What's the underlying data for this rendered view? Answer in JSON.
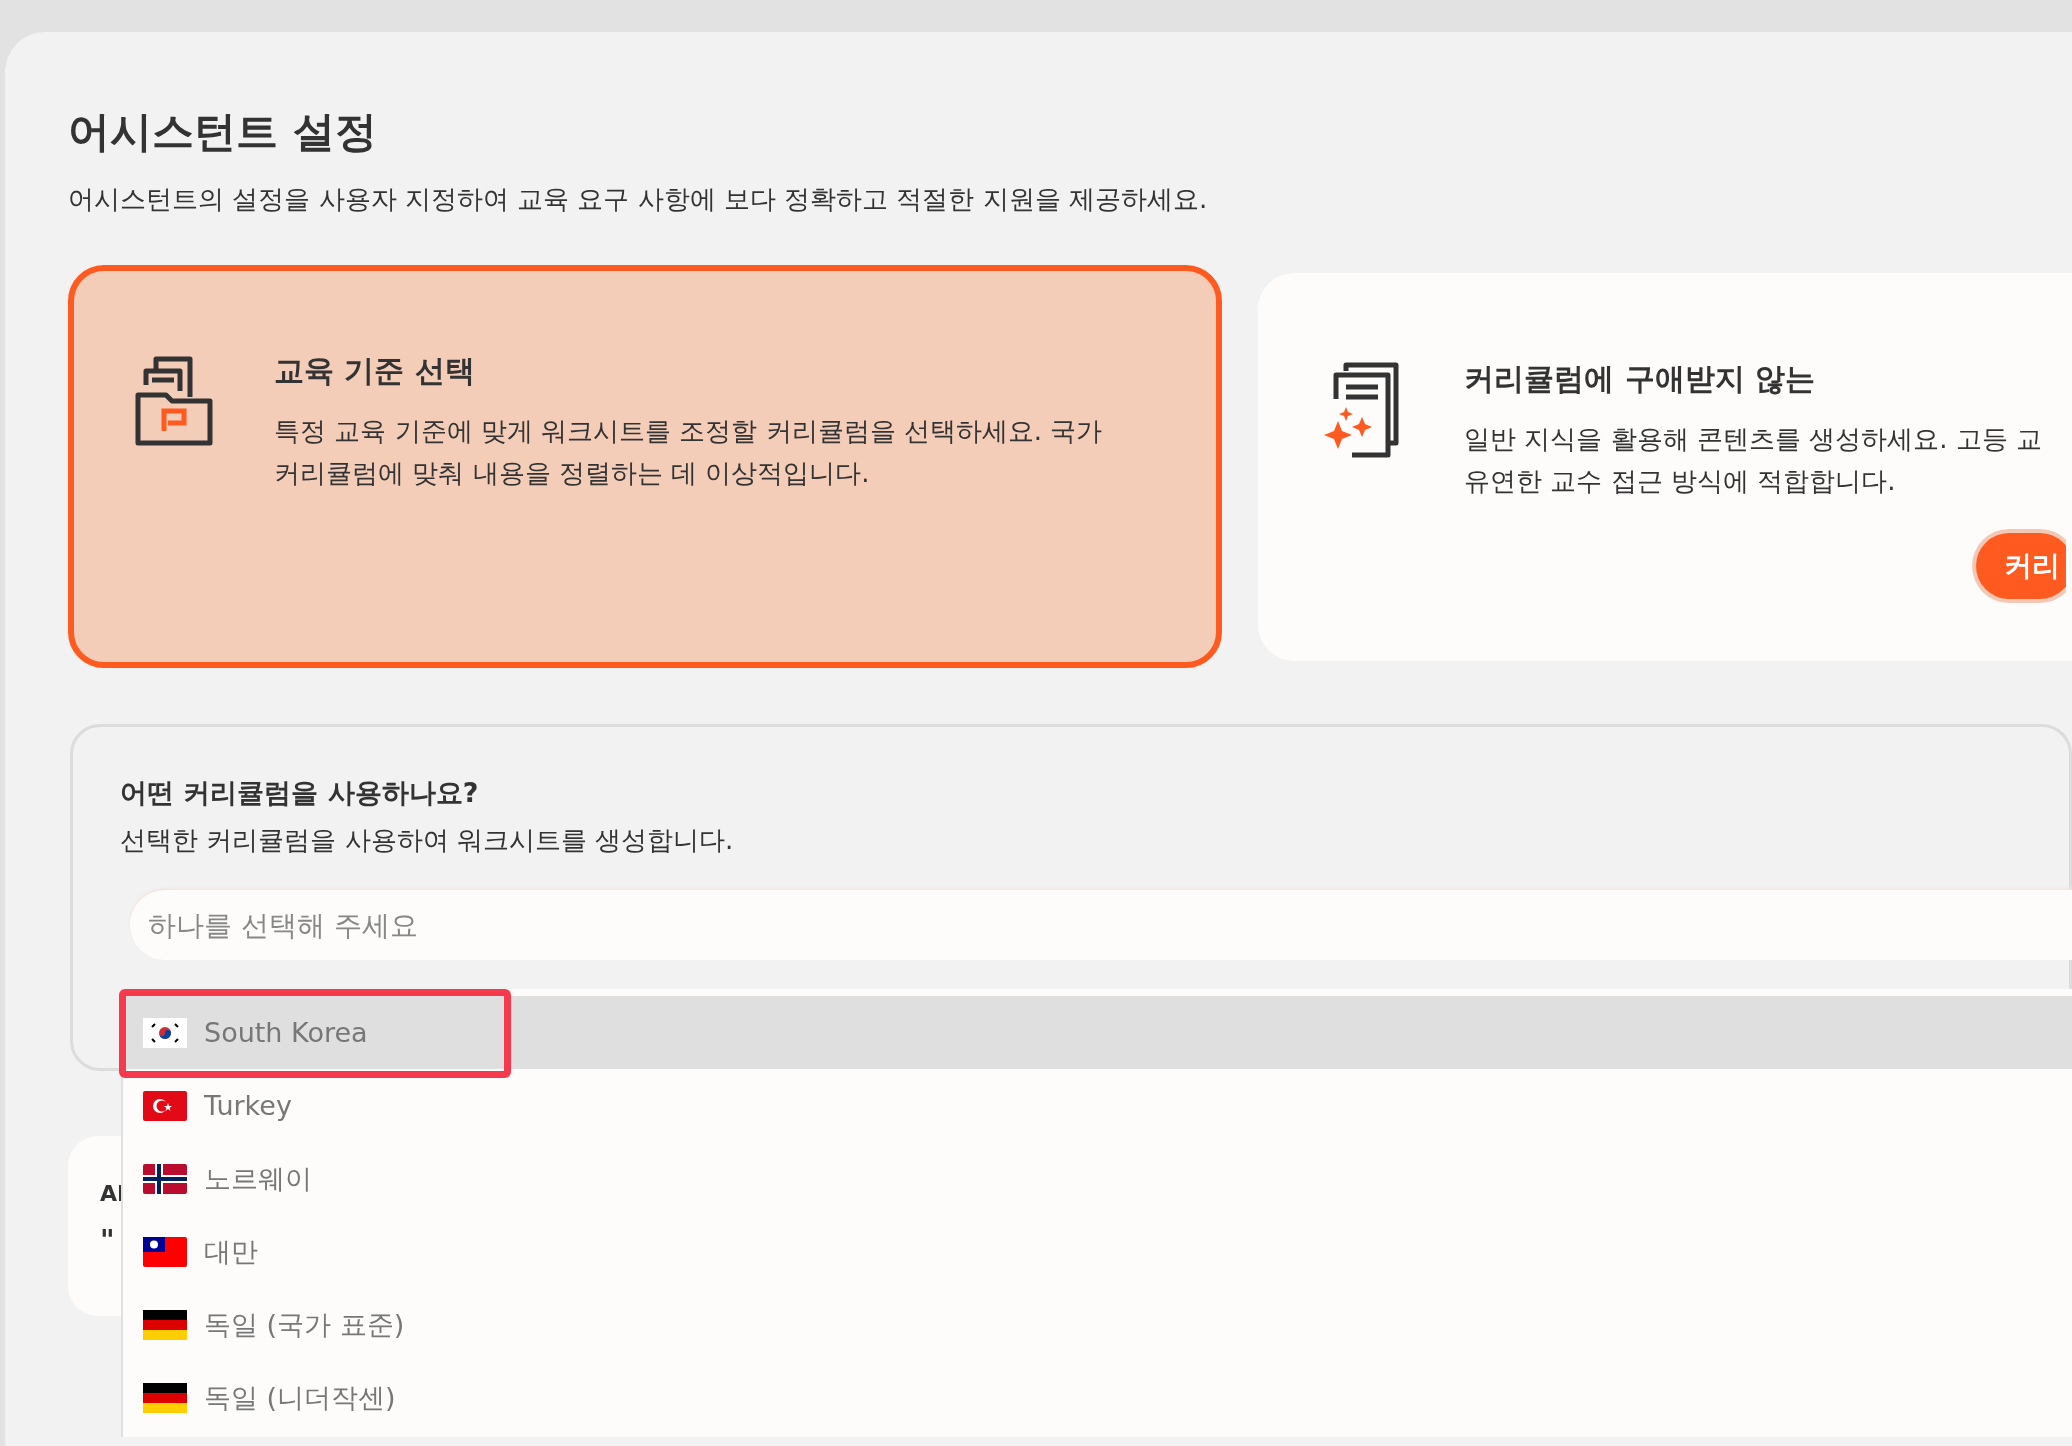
{
  "page": {
    "title": "어시스턴트 설정",
    "subtitle": "어시스턴트의 설정을 사용자 지정하여 교육 요구 사항에 보다 정확하고 적절한 지원을 제공하세요."
  },
  "mode_cards": [
    {
      "title": "교육 기준 선택",
      "description": "특정 교육 기준에 맞게 워크시트를 조정할 커리큘럼을 선택하세요. 국가 커리큘럼에 맞춰 내용을 정렬하는 데 이상적입니다.",
      "selected": true
    },
    {
      "title": "커리큘럼에 구애받지 않는",
      "description": "일반 지식을 활용해 콘텐츠를 생성하세요. 고등 교\n유연한 교수 접근 방식에 적합합니다.",
      "selected": false,
      "button": "커리"
    }
  ],
  "curriculum": {
    "heading": "어떤 커리큘럼을 사용하나요?",
    "description": "선택한 커리큘럼을 사용하여 워크시트를 생성합니다.",
    "placeholder": "하나를 선택해 주세요",
    "options": [
      {
        "label": "South Korea",
        "selected": true
      },
      {
        "label": "Turkey",
        "selected": false
      },
      {
        "label": "노르웨이",
        "selected": false
      },
      {
        "label": "대만",
        "selected": false
      },
      {
        "label": "독일 (국가 표준)",
        "selected": false
      },
      {
        "label": "독일 (니더작센)",
        "selected": false
      }
    ]
  },
  "hidden_card": {
    "label": "AI",
    "quote": "\""
  }
}
